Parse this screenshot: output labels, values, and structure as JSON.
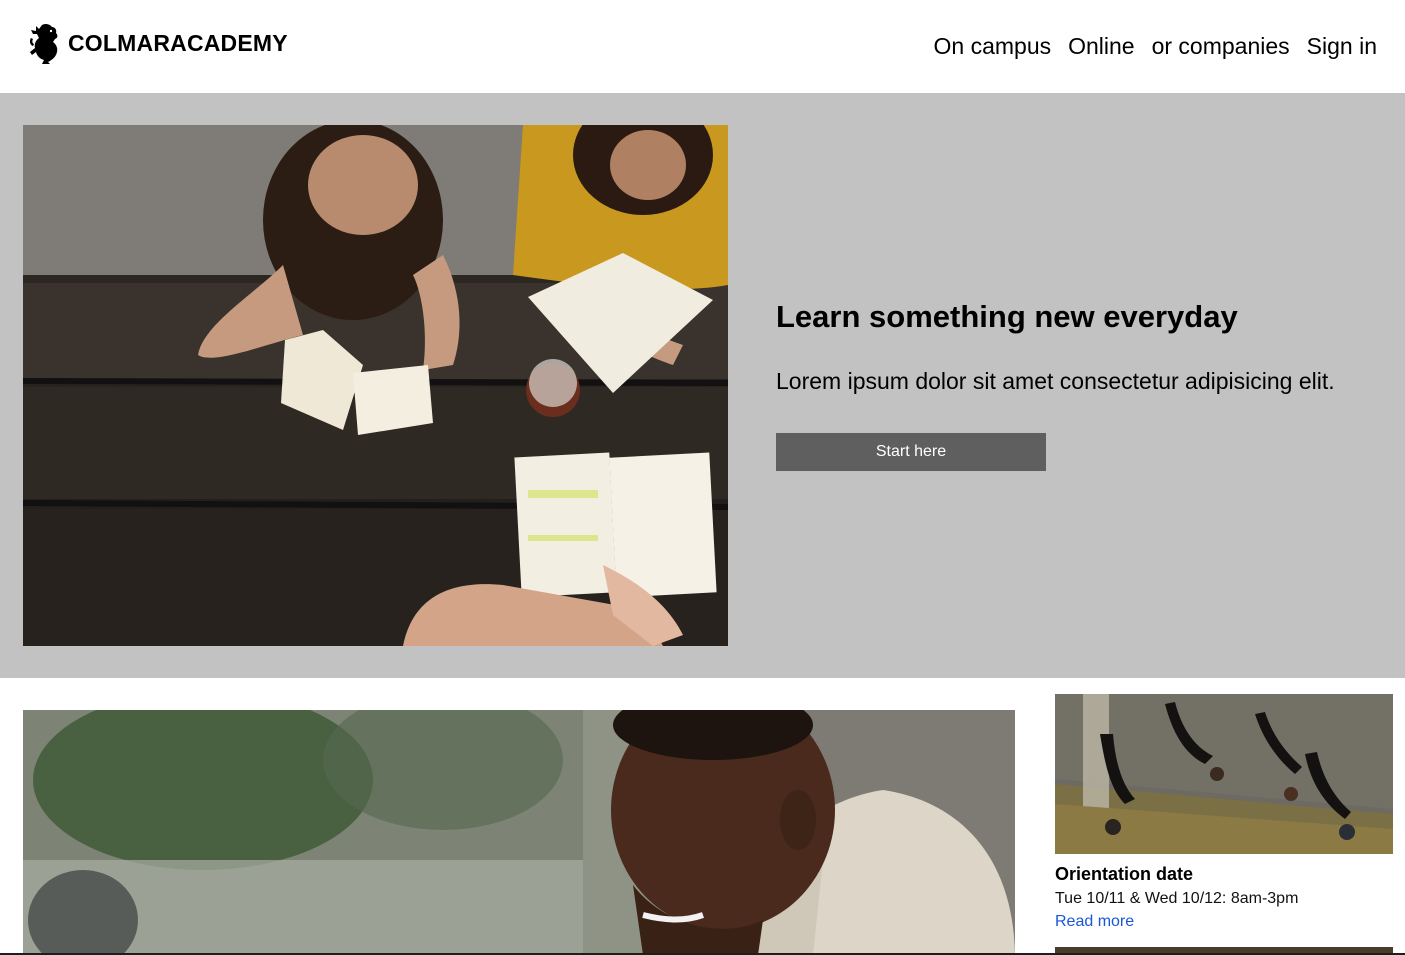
{
  "brand": {
    "name": "COLMARACADEMY",
    "logo_icon": "lion-rampant-icon"
  },
  "nav": {
    "items": [
      {
        "label": "On campus"
      },
      {
        "label": "Online"
      },
      {
        "label": "or companies"
      },
      {
        "label": "Sign in"
      }
    ]
  },
  "hero": {
    "title": "Learn something new everyday",
    "subtitle": "Lorem ipsum dolor sit amet consectetur adipisicing elit.",
    "button_label": "Start here",
    "image": "students-studying-at-picnic-table"
  },
  "feature": {
    "image": "smiling-man-outdoors"
  },
  "events": [
    {
      "title": "Orientation date",
      "date": "Tue 10/11 & Wed 10/12: 8am-3pm",
      "link_label": "Read more",
      "image": "aerial-people-walking-shadows"
    }
  ],
  "colors": {
    "hero_bg": "#c2c2c2",
    "button_bg": "#5f5f5f",
    "link": "#1a57d6"
  }
}
